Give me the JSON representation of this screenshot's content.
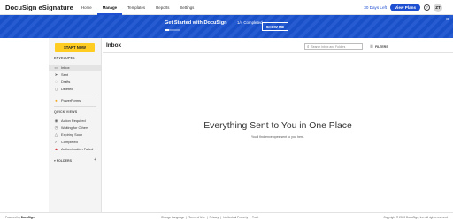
{
  "topnav": {
    "logo": "DocuSign eSignature",
    "links": [
      "Home",
      "Manage",
      "Templates",
      "Reports",
      "Settings"
    ],
    "active_link": "Manage",
    "days_left": "30 Days Left",
    "view_plans": "View Plans",
    "help_glyph": "?",
    "avatar_initials": "ZT"
  },
  "banner": {
    "title": "Get Started with DocuSign",
    "completed": "1/4 Completed",
    "progress_fraction": 0.25,
    "show_me": "SHOW ME",
    "close_glyph": "×"
  },
  "sidebar": {
    "start_now": "START NOW",
    "envelopes_label": "ENVELOPES",
    "envelope_items": [
      {
        "label": "Inbox",
        "icon": "inbox-icon",
        "glyph": "▭"
      },
      {
        "label": "Sent",
        "icon": "send-icon",
        "glyph": "➤"
      },
      {
        "label": "Drafts",
        "icon": "draft-icon",
        "glyph": "◌"
      },
      {
        "label": "Deleted",
        "icon": "trash-icon",
        "glyph": "▯"
      }
    ],
    "powerforms": {
      "label": "PowerForms",
      "icon": "powerforms-icon",
      "glyph": "●"
    },
    "quick_views_label": "QUICK VIEWS",
    "quick_views": [
      {
        "label": "Action Required",
        "icon": "action-required-icon",
        "glyph": "◉"
      },
      {
        "label": "Waiting for Others",
        "icon": "clock-icon",
        "glyph": "◷"
      },
      {
        "label": "Expiring Soon",
        "icon": "warning-icon",
        "glyph": "△"
      },
      {
        "label": "Completed",
        "icon": "check-icon",
        "glyph": "✓"
      },
      {
        "label": "Authentication Failed",
        "icon": "alert-icon",
        "glyph": "▲"
      }
    ],
    "folders_label": "▾ FOLDERS",
    "folders_add": "+"
  },
  "main": {
    "title": "Inbox",
    "search_placeholder": "Search Inbox and Folders",
    "filters_label": "FILTERS",
    "empty_title": "Everything Sent to You in One Place",
    "empty_subtitle": "You'll find envelopes sent to you here."
  },
  "footer": {
    "powered_prefix": "Powered by ",
    "powered_brand": "DocuSign",
    "links": [
      "Change Language",
      "Terms of Use",
      "Privacy",
      "Intellectual Property",
      "Trust"
    ],
    "link_separator": "|",
    "copyright": "Copyright © 2020 DocuSign, Inc. All rights reserved"
  },
  "colors": {
    "brand_blue": "#1a52cf",
    "cta_yellow": "#ffcc22",
    "powerforms_dot": "#f5a623",
    "auth_failed": "#d43d3d"
  }
}
